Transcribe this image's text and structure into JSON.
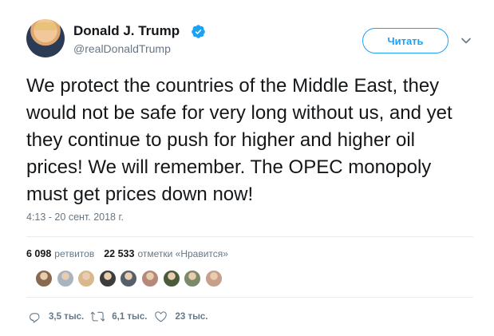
{
  "author": {
    "display_name": "Donald J. Trump",
    "screen_name": "@realDonaldTrump",
    "verified": true
  },
  "follow_button": {
    "label": "Читать"
  },
  "tweet": {
    "text": "We protect the countries of the Middle East, they would not be safe for very long without us, and yet they continue to push for higher and higher oil prices! We will remember. The OPEC monopoly must get prices down now!",
    "timestamp": "4:13 - 20 сент. 2018 г."
  },
  "stats": {
    "retweets_count": "6 098",
    "retweets_label": "ретвитов",
    "likes_count": "22 533",
    "likes_label": "отметки «Нравится»"
  },
  "likers": [
    {
      "color": "#8a6a4e"
    },
    {
      "color": "#aab4be"
    },
    {
      "color": "#d9b98c"
    },
    {
      "color": "#3d3d3d"
    },
    {
      "color": "#56606b"
    },
    {
      "color": "#b58a7a"
    },
    {
      "color": "#4a5a3a"
    },
    {
      "color": "#7d8a6a"
    },
    {
      "color": "#c89f8c"
    }
  ],
  "actions": {
    "replies": "3,5 тыс.",
    "retweets": "6,1 тыс.",
    "likes": "23 тыс."
  },
  "colors": {
    "accent": "#1da1f2",
    "text": "#14171a",
    "secondary": "#657786"
  }
}
